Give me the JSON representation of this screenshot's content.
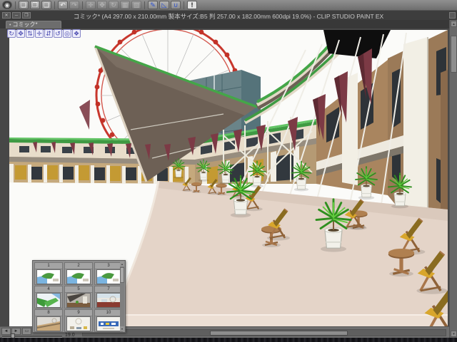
{
  "titlebar": {
    "title": "コミック* (A4 297.00 x 210.00mm 製本サイズ:B5 判 257.00 x 182.00mm 600dpi 19.0%)  - CLIP STUDIO PAINT EX"
  },
  "window_controls": {
    "close": "✕",
    "minimize": "─",
    "restore": "❐"
  },
  "document_tab": {
    "modified_dot": "•",
    "label": "コミック*"
  },
  "command_bar": {
    "buttons": [
      {
        "name": "clip-studio-logo",
        "glyph": "◉",
        "enabled": true
      },
      {
        "name": "new-document-icon",
        "glyph": "❏",
        "enabled": true
      },
      {
        "name": "open-file-icon",
        "glyph": "❐",
        "enabled": true
      },
      {
        "name": "save-file-icon",
        "glyph": "❑",
        "enabled": true
      },
      {
        "name": "undo-icon",
        "glyph": "↶",
        "enabled": true
      },
      {
        "name": "redo-icon",
        "glyph": "↷",
        "enabled": false
      },
      {
        "name": "snap-settings-icon",
        "glyph": "✛",
        "enabled": false
      },
      {
        "name": "move-tool-icon",
        "glyph": "✥",
        "enabled": false
      },
      {
        "name": "rotate-view-icon",
        "glyph": "↻",
        "enabled": false
      },
      {
        "name": "grid-icon",
        "glyph": "▦",
        "enabled": false
      },
      {
        "name": "selection-launcher-icon",
        "glyph": "▧",
        "enabled": false
      },
      {
        "name": "snap-to-ruler-icon",
        "glyph": "✎",
        "enabled": true
      },
      {
        "name": "snap-to-special-ruler-icon",
        "glyph": "◺",
        "enabled": true
      },
      {
        "name": "snap-to-grid-icon",
        "glyph": "∪",
        "enabled": true
      },
      {
        "name": "information-icon",
        "glyph": "!",
        "enabled": true
      }
    ]
  },
  "launcher": {
    "icons": [
      {
        "name": "camera-rotate-icon",
        "glyph": "↻"
      },
      {
        "name": "camera-translate-icon",
        "glyph": "✥"
      },
      {
        "name": "camera-dolly-icon",
        "glyph": "⇅"
      },
      {
        "name": "object-move-icon",
        "glyph": "✛"
      },
      {
        "name": "object-vertical-move-icon",
        "glyph": "⇵"
      },
      {
        "name": "object-rotate-icon",
        "glyph": "↺"
      },
      {
        "name": "object-plane-rotate-icon",
        "glyph": "◎"
      },
      {
        "name": "object-snap-icon",
        "glyph": "❖"
      }
    ]
  },
  "status": {
    "prev_page": "◄",
    "next_page": "►",
    "fit_screen": "▭",
    "zoom_value": "19.0",
    "scroll_up": "▴",
    "scroll_down": "▾"
  },
  "page_manager": {
    "pages": [
      {
        "number": "1"
      },
      {
        "number": "2"
      },
      {
        "number": "3"
      },
      {
        "number": "4"
      },
      {
        "number": "5"
      },
      {
        "number": "7"
      },
      {
        "number": "8"
      },
      {
        "number": "9"
      },
      {
        "number": "10"
      }
    ]
  },
  "colors": {
    "ferris_wheel_red": "#c8372d",
    "roof_green": "#3f9a43",
    "canopy_taupe": "#6d6055",
    "flag_maroon": "#7c3a45",
    "glass_teal": "#6a8489",
    "plaza_beige": "#e4d4c8",
    "wood_brown": "#a9764a",
    "seat_yellow": "#d8a62c",
    "pot_white": "#f2f1ea",
    "launcher_purple": "#4a4ab0",
    "snap_blue": "#2a4fd0"
  }
}
